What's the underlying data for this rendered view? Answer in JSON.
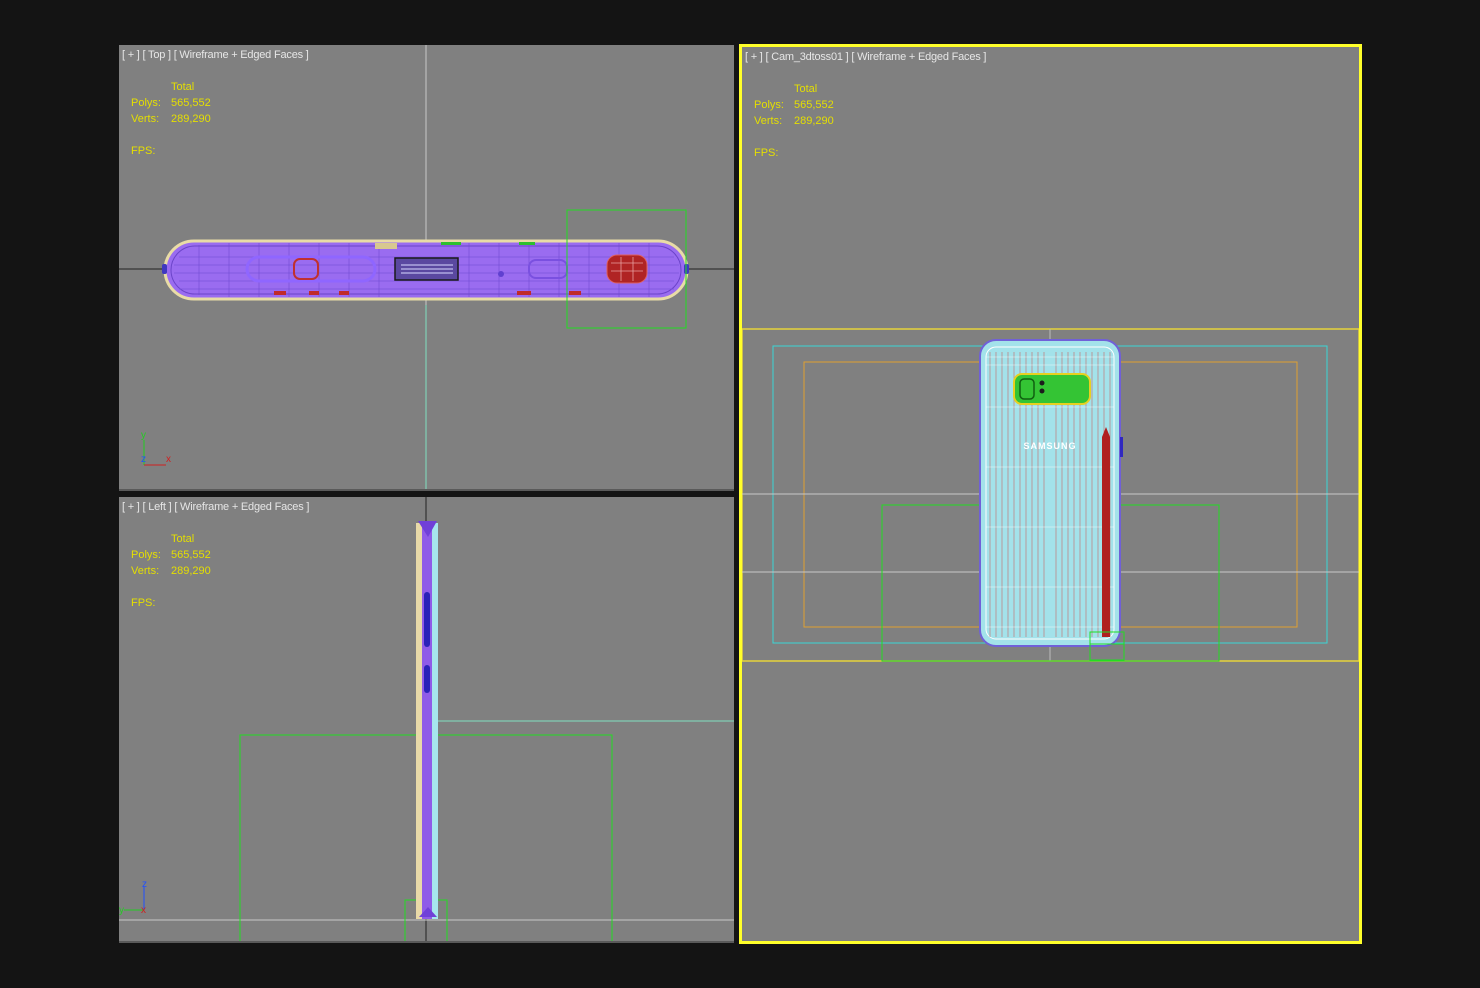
{
  "viewports": {
    "top": {
      "label": "[ + ] [ Top ] [ Wireframe + Edged Faces ]",
      "stats": {
        "total": "Total",
        "polys_label": "Polys:",
        "polys": "565,552",
        "verts_label": "Verts:",
        "verts": "289,290",
        "fps_label": "FPS:"
      },
      "axes": {
        "a": "y",
        "b": "z",
        "c": "x"
      }
    },
    "left": {
      "label": "[ + ] [ Left ] [ Wireframe + Edged Faces ]",
      "stats": {
        "total": "Total",
        "polys_label": "Polys:",
        "polys": "565,552",
        "verts_label": "Verts:",
        "verts": "289,290",
        "fps_label": "FPS:"
      },
      "axes": {
        "a": "z",
        "b": "y",
        "c": "x"
      }
    },
    "camera": {
      "label": "[ + ] [ Cam_3dtoss01 ] [ Wireframe + Edged Faces ]",
      "stats": {
        "total": "Total",
        "polys_label": "Polys:",
        "polys": "565,552",
        "verts_label": "Verts:",
        "verts": "289,290",
        "fps_label": "FPS:"
      },
      "brand_text": "SAMSUNG"
    }
  },
  "colors": {
    "viewport_bg": "#808080",
    "active_border": "#ffff2a",
    "stats_text": "#e5df00",
    "selection_green": "#22dd22",
    "wire_purple": "#8a5ce6",
    "wire_cyan": "#9fe6ee",
    "wire_cream": "#e8d9a8",
    "wire_red": "#c01818"
  }
}
